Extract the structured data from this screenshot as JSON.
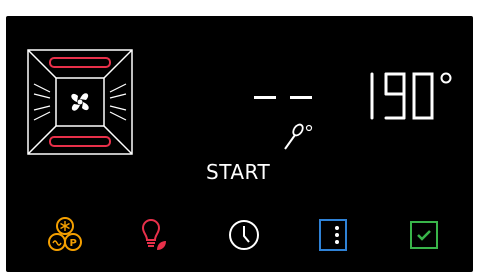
{
  "display": {
    "oven_mode_icon": "convection-fan-top-bottom-heat-icon",
    "temperature": "190",
    "temperature_unit": "°",
    "core_temp_value": "--",
    "core_probe_icon": "meat-probe-icon",
    "core_probe_unit": "°",
    "status": "START"
  },
  "buttons": [
    {
      "icon": "program-snowflake-p-icon",
      "color": "#f5a000"
    },
    {
      "icon": "lightbulb-eco-icon",
      "color": "#e8304a"
    },
    {
      "icon": "clock-icon",
      "color": "#ffffff"
    },
    {
      "icon": "options-vertical-icon",
      "color": "#2f82d6"
    },
    {
      "icon": "checkbox-confirm-icon",
      "color": "#39b54a"
    }
  ],
  "colors": {
    "background": "#000000",
    "heat_element": "#e8304a",
    "text": "#ffffff"
  }
}
